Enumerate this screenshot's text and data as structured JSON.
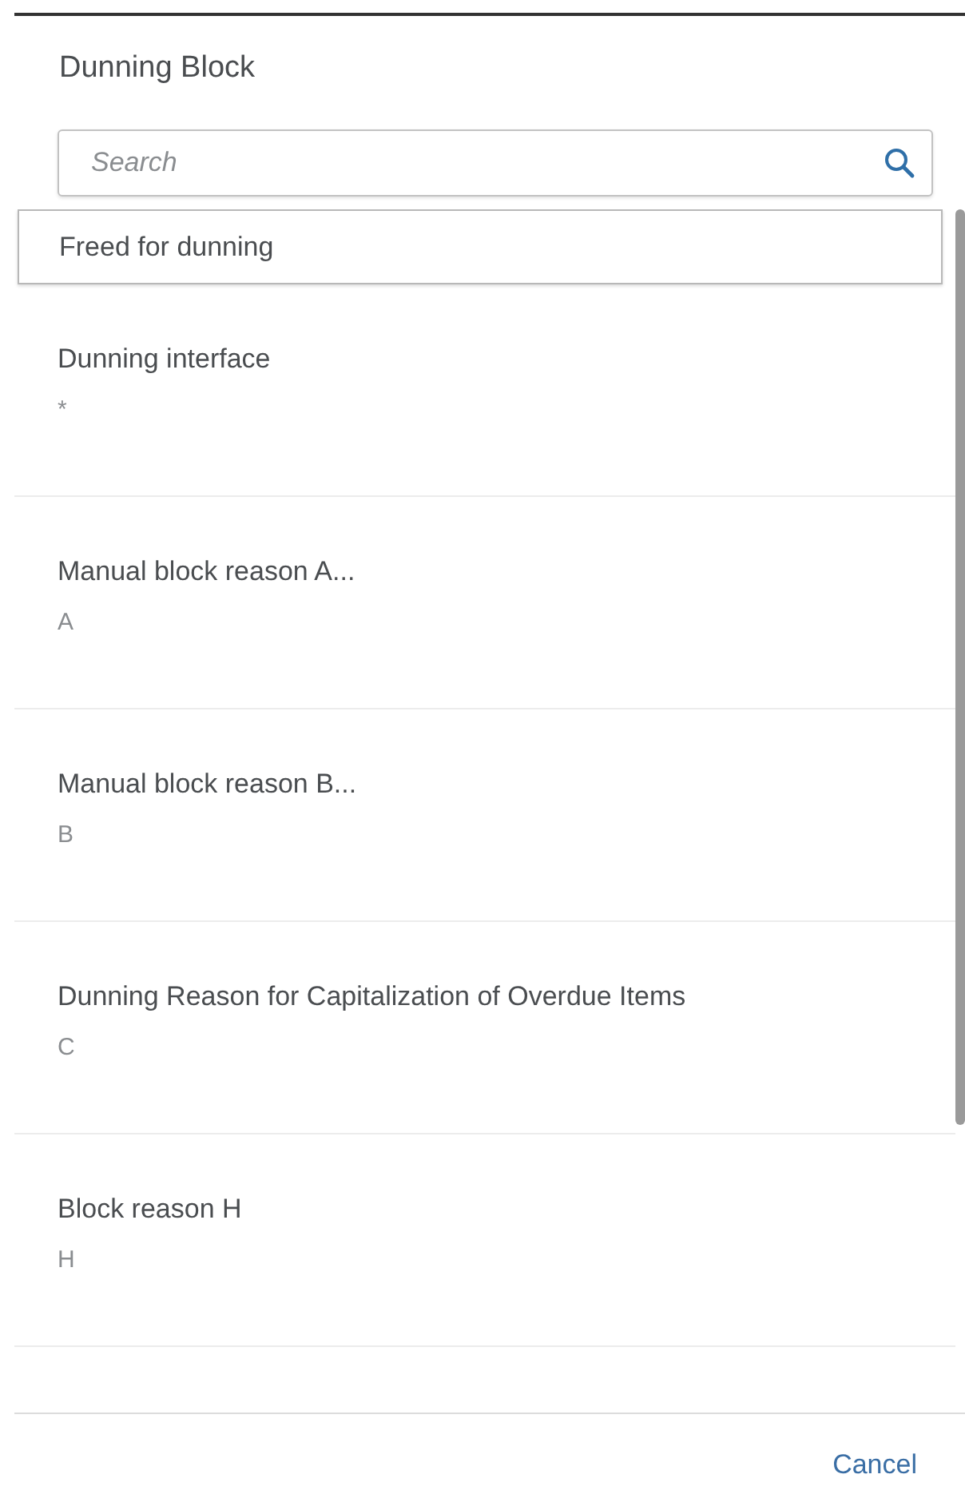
{
  "dialog": {
    "title": "Dunning Block"
  },
  "search": {
    "placeholder": "Search"
  },
  "items": [
    {
      "title": "Freed for dunning",
      "selected": true
    },
    {
      "title": "Dunning interface",
      "code": "*",
      "selected": false
    },
    {
      "title": "Manual block reason A...",
      "code": "A",
      "selected": false
    },
    {
      "title": "Manual block reason B...",
      "code": "B",
      "selected": false
    },
    {
      "title": "Dunning Reason for Capitalization of Overdue Items",
      "code": "C",
      "selected": false
    },
    {
      "title": "Block reason H",
      "code": "H",
      "selected": false
    }
  ],
  "footer": {
    "cancel": "Cancel"
  }
}
